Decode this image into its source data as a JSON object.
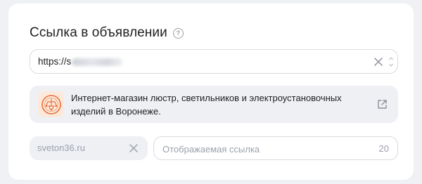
{
  "section": {
    "title": "Ссылка в объявлении",
    "help_icon": "question-circle-icon",
    "help_glyph": "?"
  },
  "url_field": {
    "value_prefix": "https://s",
    "value_redacted": true,
    "clear_icon": "close-icon",
    "spinner_icon": "spin-arrows-icon"
  },
  "preview": {
    "favicon": "chandelier-logo-icon",
    "description": "Интернет-магазин люстр, светильников и электроустановочных изделий в Воронеже.",
    "open_icon": "external-link-icon"
  },
  "domain_chip": {
    "value": "sveton36.ru",
    "clear_icon": "close-icon"
  },
  "display_link": {
    "placeholder": "Отображаемая ссылка",
    "value": "",
    "remaining": "20"
  },
  "colors": {
    "background": "#f0f1f4",
    "card": "#ffffff",
    "muted_text": "#9ba1ab",
    "chip_bg": "#eef0f4",
    "favicon_accent": "#e8703a"
  }
}
